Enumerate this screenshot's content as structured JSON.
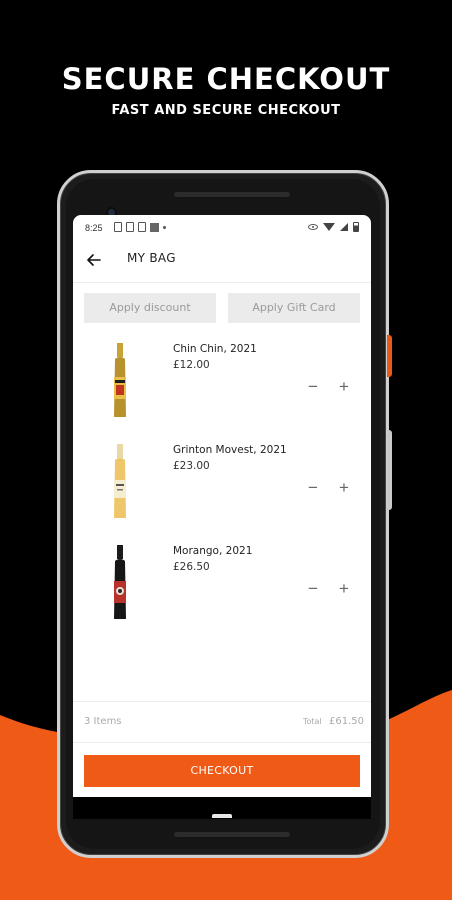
{
  "promo": {
    "headline": "SECURE CHECKOUT",
    "subheadline": "FAST AND SECURE CHECKOUT",
    "colors": {
      "background": "#000000",
      "accent": "#F05A17"
    }
  },
  "status_bar": {
    "time": "8:25",
    "icons": [
      "notification-icon",
      "notification-icon",
      "sim-icon",
      "app-icon",
      "dot-icon",
      "eye-icon",
      "wifi-icon",
      "signal-icon",
      "battery-icon"
    ]
  },
  "header": {
    "back_icon": "back-arrow-icon",
    "title": "MY BAG"
  },
  "actions": {
    "apply_discount": "Apply discount",
    "apply_gift_card": "Apply Gift Card"
  },
  "items": [
    {
      "name": "Chin Chin, 2021",
      "price": "£12.00",
      "minus": "−",
      "plus": "+"
    },
    {
      "name": "Grinton Movest, 2021",
      "price": "£23.00",
      "minus": "−",
      "plus": "+"
    },
    {
      "name": "Morango, 2021",
      "price": "£26.50",
      "minus": "−",
      "plus": "+"
    }
  ],
  "summary": {
    "items_count": "3 Items",
    "total_label": "Total",
    "total_value": "£61.50"
  },
  "checkout": {
    "label": "CHECKOUT"
  }
}
